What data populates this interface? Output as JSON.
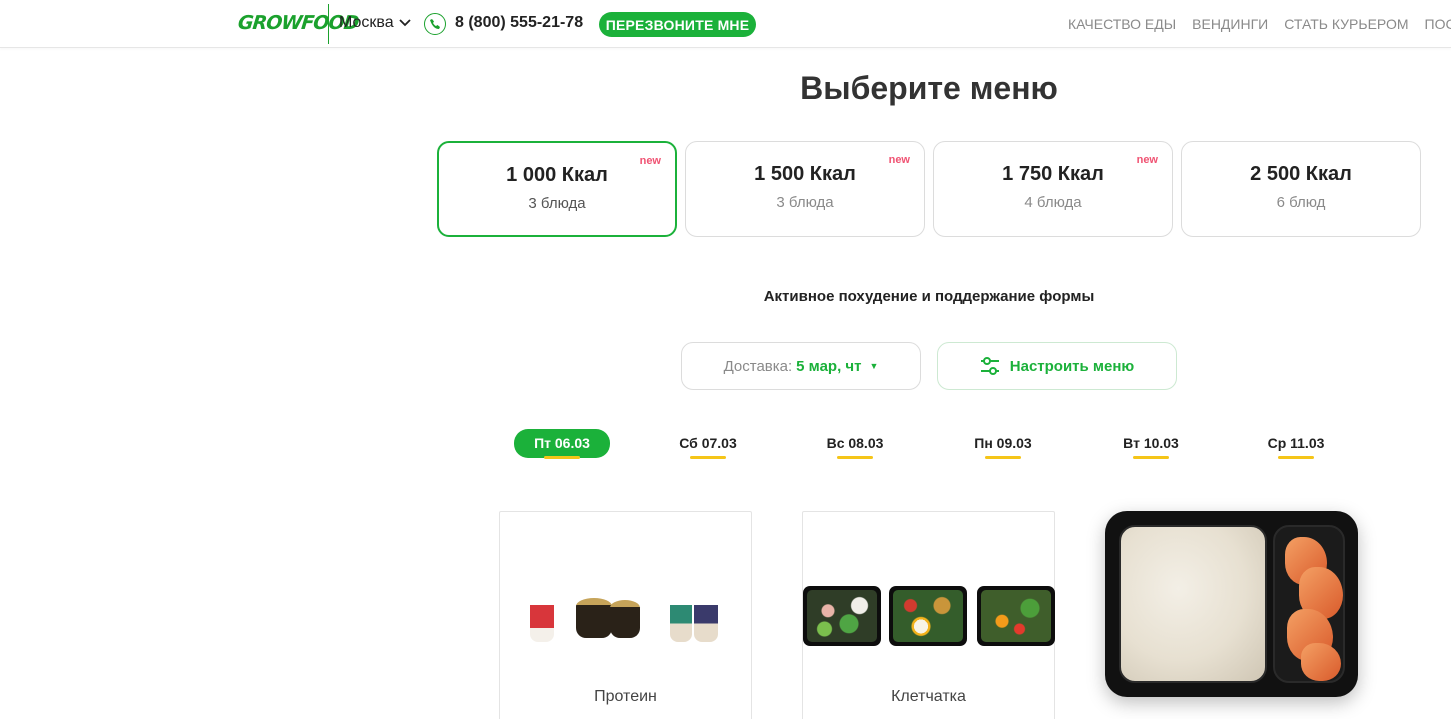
{
  "header": {
    "logo": "GROWFOOD",
    "city": "Москва",
    "phone": "8 (800) 555-21-78",
    "callback_label": "ПЕРЕЗВОНИТЕ МНЕ",
    "nav": [
      "КАЧЕСТВО ЕДЫ",
      "ВЕНДИНГИ",
      "СТАТЬ КУРЬЕРОМ",
      "ПОСТАВ"
    ]
  },
  "title": "Выберите меню",
  "calorie_cards": [
    {
      "kcal": "1 000 Ккал",
      "dishes": "3 блюда",
      "badge": "new",
      "selected": true
    },
    {
      "kcal": "1 500 Ккал",
      "dishes": "3 блюда",
      "badge": "new",
      "selected": false
    },
    {
      "kcal": "1 750 Ккал",
      "dishes": "4 блюда",
      "badge": "new",
      "selected": false
    },
    {
      "kcal": "2 500 Ккал",
      "dishes": "6 блюд",
      "badge": "",
      "selected": false
    }
  ],
  "subtitle": "Активное похудение и поддержание формы",
  "delivery": {
    "label": "Доставка:",
    "date": "5 мар, чт"
  },
  "configure_label": "Настроить меню",
  "days": [
    {
      "label": "Пт 06.03",
      "selected": true
    },
    {
      "label": "Сб 07.03",
      "selected": false
    },
    {
      "label": "Вс 08.03",
      "selected": false
    },
    {
      "label": "Пн 09.03",
      "selected": false
    },
    {
      "label": "Вт 10.03",
      "selected": false
    },
    {
      "label": "Ср 11.03",
      "selected": false
    }
  ],
  "products": [
    {
      "name": "Протеин"
    },
    {
      "name": "Клетчатка"
    }
  ],
  "colors": {
    "accent": "#1bb13a",
    "new_badge": "#f05373",
    "day_underline": "#f5c518",
    "nav_text": "#8a8a8a"
  }
}
